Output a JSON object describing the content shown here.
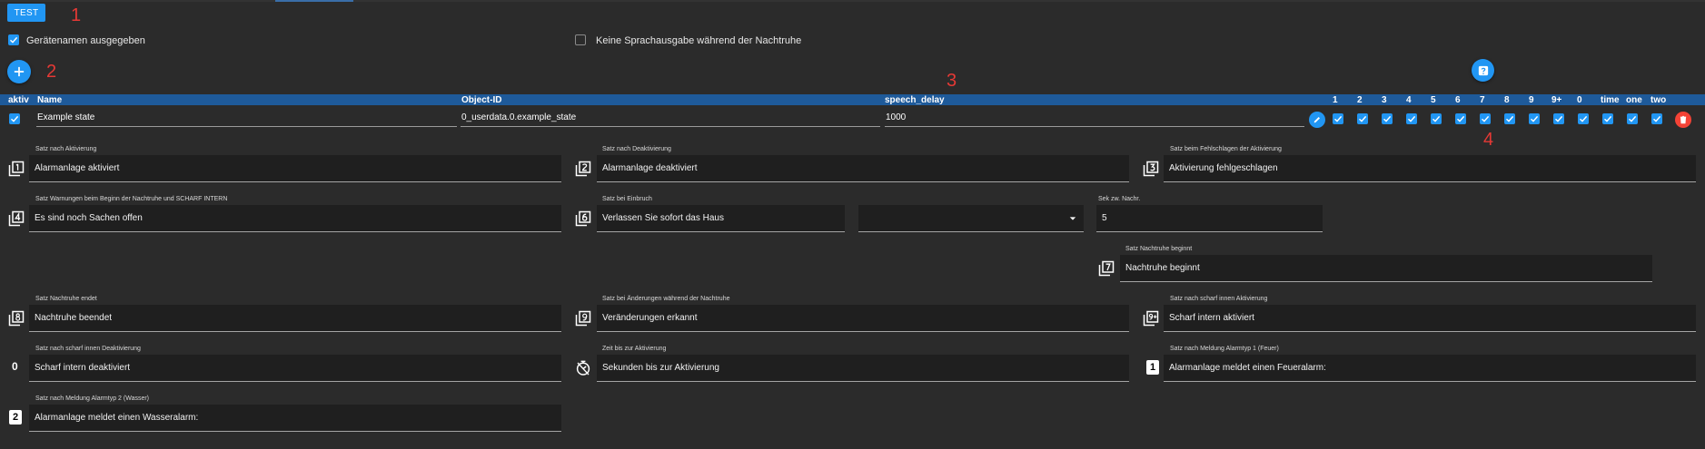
{
  "toolbar": {
    "test_label": "TEST"
  },
  "markers": [
    "1",
    "2",
    "3",
    "4"
  ],
  "options": {
    "device_names": {
      "label": "Gerätenamen ausgegeben",
      "checked": true
    },
    "no_speech_night": {
      "label": "Keine Sprachausgabe während der Nachtruhe",
      "checked": false
    }
  },
  "table": {
    "headers": {
      "aktiv": "aktiv",
      "name": "Name",
      "object_id": "Object-ID",
      "speech_delay": "speech_delay",
      "cols": [
        "1",
        "2",
        "3",
        "4",
        "5",
        "6",
        "7",
        "8",
        "9",
        "9+",
        "0",
        "time",
        "one",
        "two"
      ]
    },
    "row": {
      "name": "Example state",
      "object_id": "0_userdata.0.example_state",
      "speech_delay": "1000"
    }
  },
  "fields": {
    "f1": {
      "label": "Satz nach Aktivierung",
      "value": "Alarmanlage aktiviert",
      "icon": "filter-1-icon"
    },
    "f2": {
      "label": "Satz nach Deaktivierung",
      "value": "Alarmanlage deaktiviert",
      "icon": "filter-2-icon"
    },
    "f3": {
      "label": "Satz beim Fehlschlagen der Aktivierung",
      "value": "Aktivierung fehlgeschlagen",
      "icon": "filter-3-icon"
    },
    "f4": {
      "label": "Satz Warnungen beim Beginn der Nachtruhe und SCHARF INTERN",
      "value": "Es sind noch Sachen offen",
      "icon": "filter-4-icon"
    },
    "f5": {
      "label": "Satz bei Einbruch",
      "value": "Verlassen Sie sofort das Haus",
      "icon": "filter-6-icon"
    },
    "f5_select": {
      "value": ""
    },
    "f6": {
      "label": "Sek zw. Nachr.",
      "value": "5"
    },
    "f7": {
      "label": "Satz Nachtruhe beginnt",
      "value": "Nachtruhe beginnt",
      "icon": "filter-7-icon"
    },
    "f8": {
      "label": "Satz Nachtruhe endet",
      "value": "Nachtruhe beendet",
      "icon": "filter-8-icon"
    },
    "f9": {
      "label": "Satz bei Änderungen während der Nachtruhe",
      "value": "Veränderungen erkannt",
      "icon": "filter-9-icon"
    },
    "f10": {
      "label": "Satz nach scharf innen Aktivierung",
      "value": "Scharf intern aktiviert",
      "icon": "filter-9-plus-icon"
    },
    "f11": {
      "label": "Satz nach scharf innen Deaktivierung",
      "value": "Scharf intern deaktiviert",
      "icon_text": "0"
    },
    "f12": {
      "label": "Zeit bis zur Aktivierung",
      "value": "Sekunden bis zur Aktivierung",
      "icon": "timer-icon"
    },
    "f13": {
      "label": "Satz nach Meldung Alarmtyp 1 (Feuer)",
      "value": "Alarmanlage meldet einen Feueralarm:",
      "icon_text": "1"
    },
    "f14": {
      "label": "Satz nach Meldung Alarmtyp 2 (Wasser)",
      "value": "Alarmanlage meldet einen Wasseralarm:",
      "icon_text": "2"
    }
  },
  "colors": {
    "accent": "#2196f3",
    "header": "#1e5a9a",
    "delete": "#f44336",
    "marker": "#e53935",
    "bg": "#2b2b2b",
    "field": "#1f1f1f"
  }
}
